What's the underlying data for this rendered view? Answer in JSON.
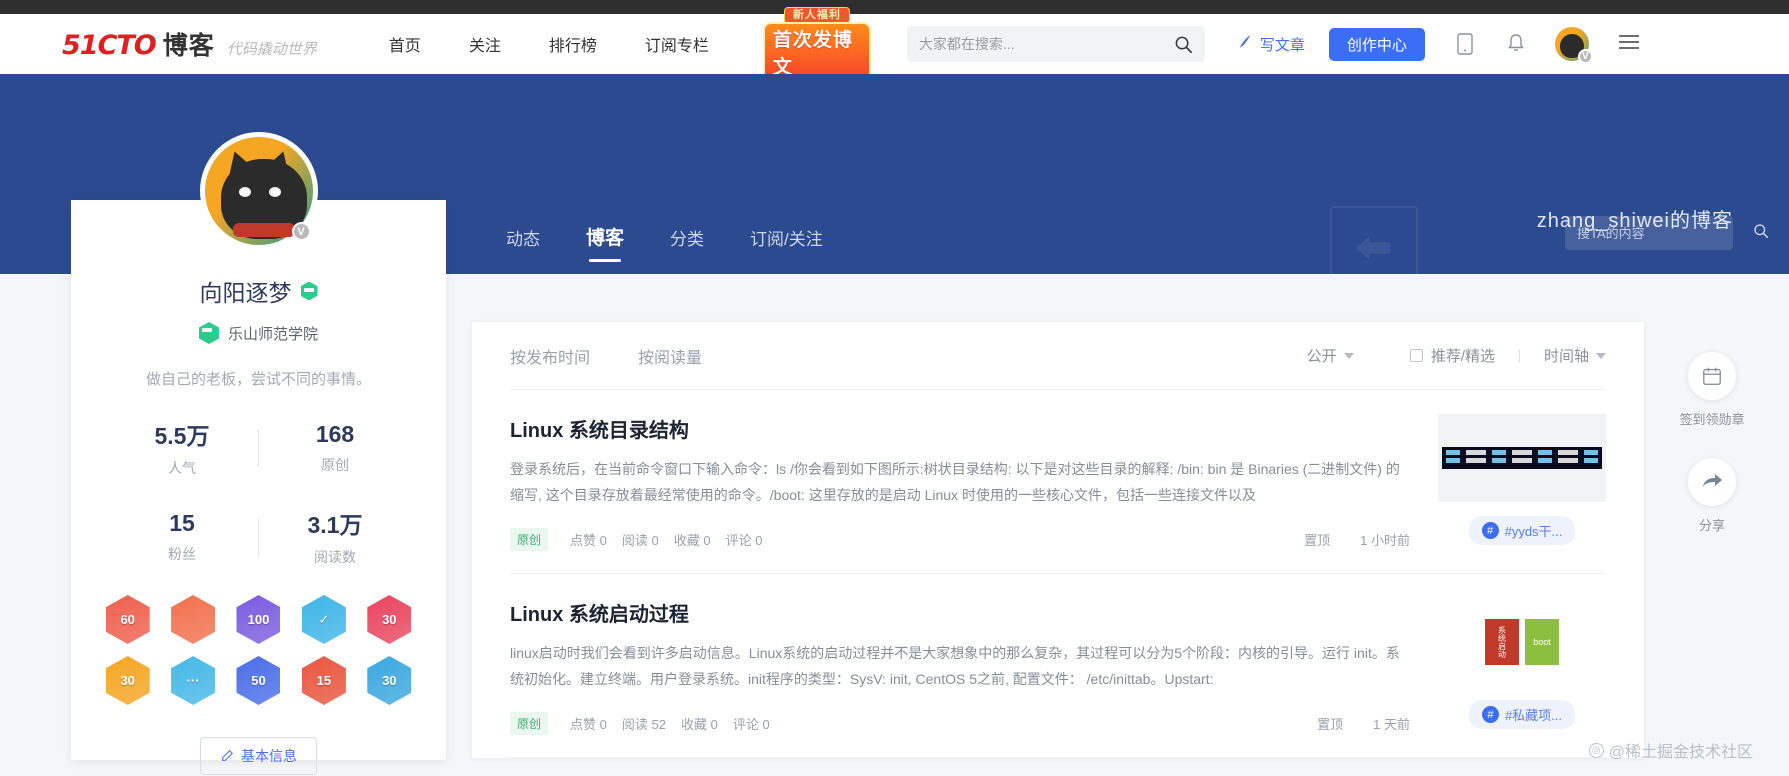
{
  "header": {
    "logo_main": "51CTO",
    "logo_sub": "博客",
    "logo_slogan": "代码撬动世界",
    "nav": [
      {
        "label": "首页"
      },
      {
        "label": "关注"
      },
      {
        "label": "排行榜"
      },
      {
        "label": "订阅专栏"
      }
    ],
    "promo": {
      "top": "新人福利",
      "bottom": "首次发博文"
    },
    "search": {
      "placeholder": "大家都在搜索...",
      "value": "",
      "icon": "search-icon"
    },
    "write_label": "写文章",
    "create_label": "创作中心",
    "icons": [
      "mobile-icon",
      "bell-icon",
      "hamburger-icon"
    ],
    "avatar_badge": "V"
  },
  "banner": {
    "title": "zhang_shiwei的博客",
    "tabs": [
      {
        "label": "动态",
        "active": false
      },
      {
        "label": "博客",
        "active": true
      },
      {
        "label": "分类",
        "active": false
      },
      {
        "label": "订阅/关注",
        "active": false
      }
    ],
    "search": {
      "placeholder": "搜TA的内容",
      "value": "",
      "icon": "search-icon"
    },
    "bg_color": "#2c4a8f"
  },
  "profile": {
    "name": "向阳逐梦",
    "verified_badge": "V",
    "school": "乐山师范学院",
    "bio": "做自己的老板，尝试不同的事情。",
    "stats": [
      {
        "value": "5.5万",
        "label": "人气"
      },
      {
        "value": "168",
        "label": "原创"
      },
      {
        "value": "15",
        "label": "粉丝"
      },
      {
        "value": "3.1万",
        "label": "阅读数"
      }
    ],
    "badges": [
      {
        "text": "60",
        "color": "#f0604d"
      },
      {
        "text": "",
        "color": "#f2714e"
      },
      {
        "text": "100",
        "color": "#7b5ce0"
      },
      {
        "text": "✓",
        "color": "#3fb6e8"
      },
      {
        "text": "30",
        "color": "#e8465f"
      },
      {
        "text": "30",
        "color": "#f5a623"
      },
      {
        "text": "···",
        "color": "#46b8e8"
      },
      {
        "text": "50",
        "color": "#4c6ee8"
      },
      {
        "text": "15",
        "color": "#e8563f"
      },
      {
        "text": "30",
        "color": "#3ba8e0"
      }
    ],
    "basic_info_label": "基本信息"
  },
  "content": {
    "sort_options": [
      {
        "label": "按发布时间",
        "active": true
      },
      {
        "label": "按阅读量",
        "active": false
      }
    ],
    "visibility": "公开",
    "recommend_label": "推荐/精选",
    "timeline_label": "时间轴",
    "articles": [
      {
        "title": "Linux 系统目录结构",
        "desc": "登录系统后，在当前命令窗口下输入命令：ls /你会看到如下图所示:树状目录结构: 以下是对这些目录的解释: /bin: bin 是 Binaries (二进制文件) 的缩写, 这个目录存放着最经常使用的命令。/boot: 这里存放的是启动 Linux 时使用的一些核心文件，包括一些连接文件以及",
        "tag": "原创",
        "stats": [
          {
            "label": "点赞",
            "value": "0"
          },
          {
            "label": "阅读",
            "value": "0"
          },
          {
            "label": "收藏",
            "value": "0"
          },
          {
            "label": "评论",
            "value": "0"
          }
        ],
        "pinned": "置顶",
        "time": "1 小时前",
        "hashtag": "#yyds干...",
        "thumb": "terminal-screenshot"
      },
      {
        "title": "Linux 系统启动过程",
        "desc": "linux启动时我们会看到许多启动信息。Linux系统的启动过程并不是大家想象中的那么复杂，其过程可以分为5个阶段：内核的引导。运行 init。系统初始化。建立终端。用户登录系统。init程序的类型：SysV: init, CentOS 5之前, 配置文件： /etc/inittab。Upstart:",
        "tag": "原创",
        "stats": [
          {
            "label": "点赞",
            "value": "0"
          },
          {
            "label": "阅读",
            "value": "52"
          },
          {
            "label": "收藏",
            "value": "0"
          },
          {
            "label": "评论",
            "value": "0"
          }
        ],
        "pinned": "置顶",
        "time": "1 天前",
        "hashtag": "#私藏项...",
        "thumb": "boot-diagram"
      }
    ]
  },
  "rail": [
    {
      "label": "签到领勋章",
      "icon": "calendar-icon"
    },
    {
      "label": "分享",
      "icon": "share-icon"
    }
  ],
  "watermark": "@稀土掘金技术社区"
}
